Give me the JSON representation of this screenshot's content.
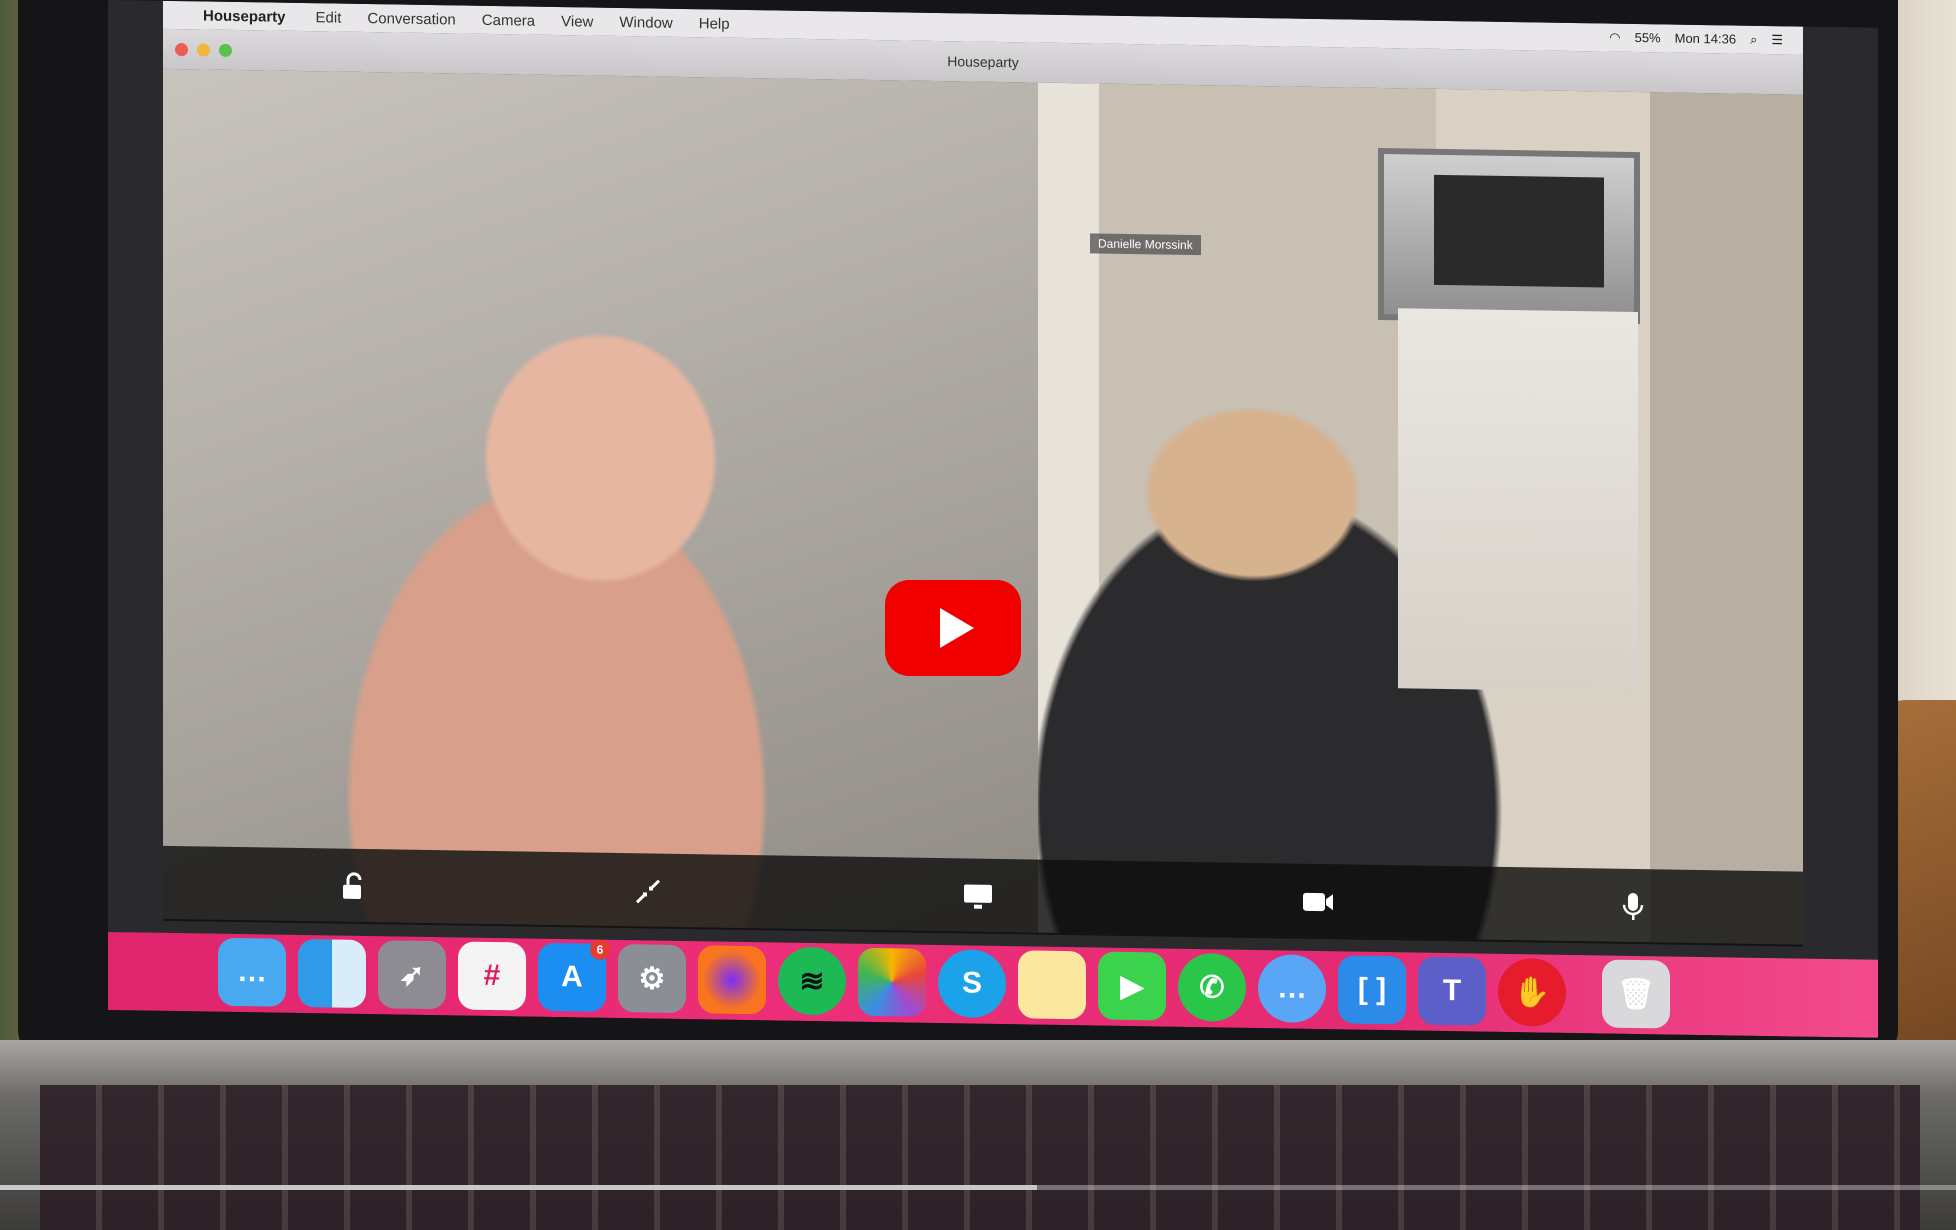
{
  "menubar": {
    "app_name": "Houseparty",
    "items": [
      "Edit",
      "Conversation",
      "Camera",
      "View",
      "Window",
      "Help"
    ],
    "battery": "55%",
    "clock": "Mon 14:36"
  },
  "window": {
    "title": "Houseparty"
  },
  "participants": [
    {
      "name": ""
    },
    {
      "name": "Danielle Morssink"
    }
  ],
  "dock": {
    "app_store_badge": "6",
    "skype_letter": "S",
    "teams_letter": "T"
  },
  "video_player": {
    "progress": 0.53,
    "accent": "#f20000"
  },
  "colors": {
    "dock": "#ec2f78"
  }
}
